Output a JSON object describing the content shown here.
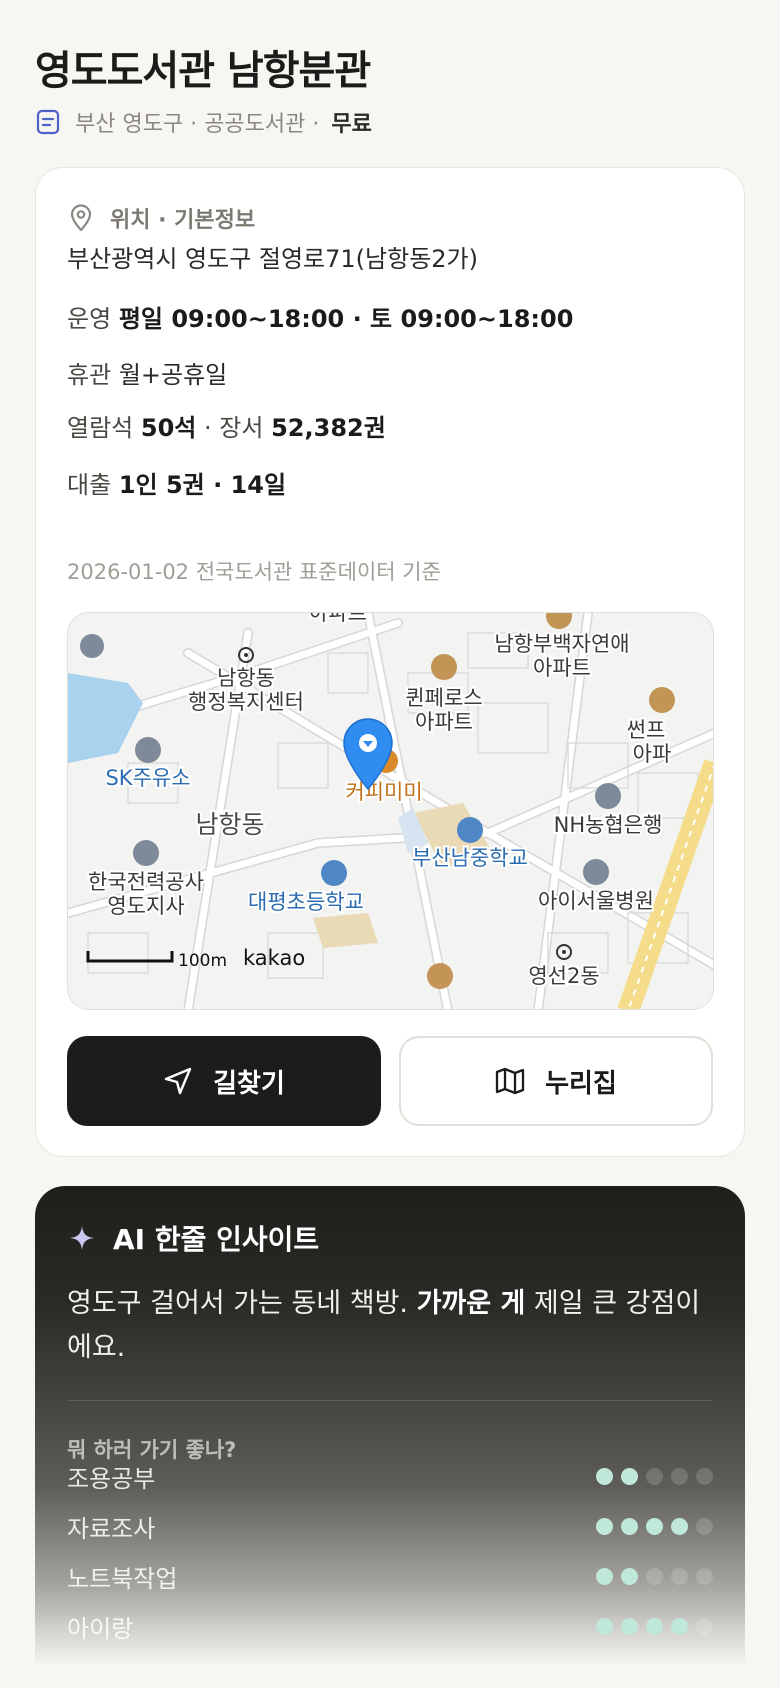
{
  "header": {
    "title": "영도도서관 남항분관",
    "meta": "부산 영도구 · 공공도서관 ·",
    "fee": "무료"
  },
  "info": {
    "section_title": "위치 · 기본정보",
    "address": "부산광역시 영도구 절영로71(남항동2가)",
    "hours_label": "운영",
    "hours_value": "평일 09:00~18:00 · 토 09:00~18:00",
    "closed_label": "휴관",
    "closed_value": "월+공휴일",
    "seats_label": "열람석",
    "seats_value": "50석",
    "sep": "·",
    "books_label": "장서",
    "books_value": "52,382권",
    "loan_label": "대출",
    "loan_value": "1인 5권 · 14일",
    "data_note": "2026-01-02 전국도서관 표준데이터 기준"
  },
  "map": {
    "labels": {
      "namhang_office": [
        "남항동",
        "행정복지센터"
      ],
      "queen": [
        "퀸페로스",
        "아파트"
      ],
      "namhangbu": [
        "남항부백자연애",
        "아파트"
      ],
      "sun": [
        "썬프",
        "아파"
      ],
      "sk": "SK주유소",
      "cafe": "커피미미",
      "namhangdong": "남항동",
      "nh": "NH농협은행",
      "busan_school": "부산남중학교",
      "kepco": [
        "한국전력공사",
        "영도지사"
      ],
      "daepyeong": "대평초등학교",
      "isoul": "아이서울병원",
      "yeongseon": "영선2동",
      "top_apt": "아파트",
      "scale": "100m",
      "brand": "kakao"
    }
  },
  "buttons": {
    "directions": "길찾기",
    "nurizip": "누리집"
  },
  "ai": {
    "title": "AI 한줄 인사이트",
    "text_before": "영도구 걸어서 가는 동네 책방. ",
    "text_bold": "가까운 게",
    "text_after": " 제일 큰 강점이에요.",
    "question": "뭐 하러 가기 좋나?",
    "ratings": [
      {
        "label": "조용공부",
        "score": 2
      },
      {
        "label": "자료조사",
        "score": 4
      },
      {
        "label": "노트북작업",
        "score": 2
      },
      {
        "label": "아이랑",
        "score": 4
      }
    ],
    "max_score": 5
  },
  "colors": {
    "accent_dark": "#1d1c1a",
    "dot_on": "#bfe7da",
    "map_pin": "#2f8cf0",
    "map_water": "#a9d2ee"
  }
}
